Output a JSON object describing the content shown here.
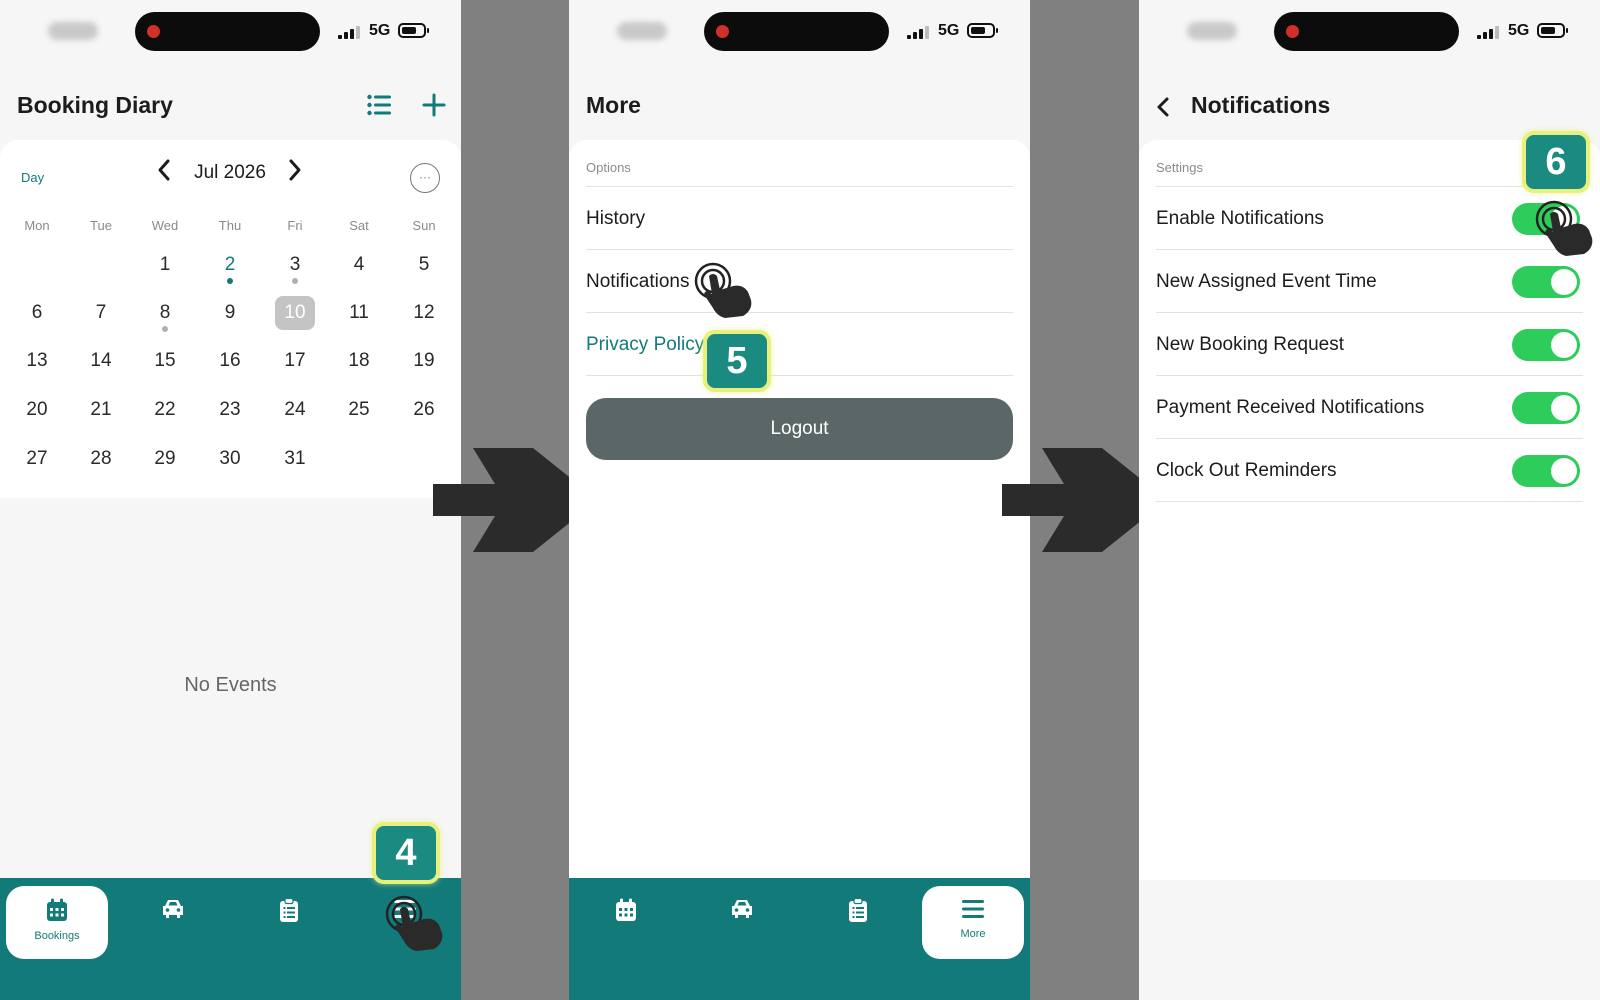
{
  "status": {
    "network": "5G"
  },
  "screen1": {
    "title": "Booking Diary",
    "view_mode": "Day",
    "month": "Jul 2026",
    "weekdays": [
      "Mon",
      "Tue",
      "Wed",
      "Thu",
      "Fri",
      "Sat",
      "Sun"
    ],
    "days": [
      "1",
      "2",
      "3",
      "4",
      "5",
      "6",
      "7",
      "8",
      "9",
      "10",
      "11",
      "12",
      "13",
      "14",
      "15",
      "16",
      "17",
      "18",
      "19",
      "20",
      "21",
      "22",
      "23",
      "24",
      "25",
      "26",
      "27",
      "28",
      "29",
      "30",
      "31"
    ],
    "selected_day": "10",
    "no_events": "No Events",
    "tabs": [
      {
        "label": "Bookings",
        "icon": "calendar-icon"
      },
      {
        "label": "",
        "icon": "car-icon"
      },
      {
        "label": "",
        "icon": "clipboard-icon"
      },
      {
        "label": "",
        "icon": "menu-icon"
      }
    ],
    "step": "4"
  },
  "screen2": {
    "title": "More",
    "section": "Options",
    "items": [
      "History",
      "Notifications",
      "Privacy Policy"
    ],
    "logout": "Logout",
    "tabs": [
      {
        "label": "",
        "icon": "calendar-icon"
      },
      {
        "label": "",
        "icon": "car-icon"
      },
      {
        "label": "",
        "icon": "clipboard-icon"
      },
      {
        "label": "More",
        "icon": "menu-icon"
      }
    ],
    "step": "5"
  },
  "screen3": {
    "title": "Notifications",
    "section": "Settings",
    "settings": [
      {
        "label": "Enable Notifications",
        "on": true
      },
      {
        "label": "New Assigned Event Time",
        "on": true
      },
      {
        "label": "New Booking Request",
        "on": true
      },
      {
        "label": "Payment Received Notifications",
        "on": true
      },
      {
        "label": "Clock Out Reminders",
        "on": true
      }
    ],
    "step": "6"
  },
  "colors": {
    "accent": "#137a7a",
    "toggle": "#2ecc5a",
    "badge": "#1b8a80",
    "badge_border": "#e6f07a",
    "logout": "#5a6766"
  }
}
